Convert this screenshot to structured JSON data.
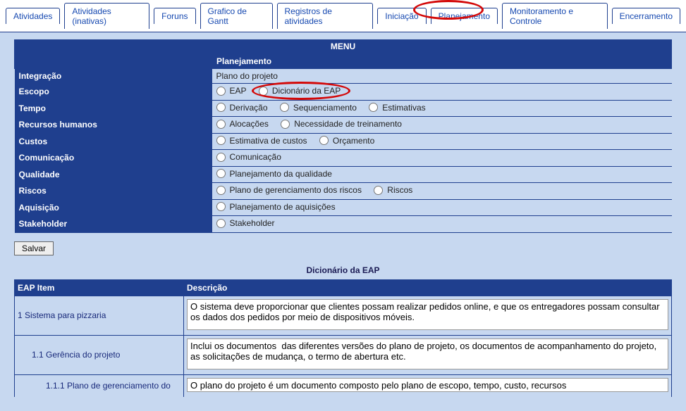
{
  "tabs": [
    {
      "label": "Atividades"
    },
    {
      "label": "Atividades (inativas)"
    },
    {
      "label": "Foruns"
    },
    {
      "label": "Grafico de Gantt"
    },
    {
      "label": "Registros de atividades"
    },
    {
      "label": "Iniciação"
    },
    {
      "label": "Planejamento"
    },
    {
      "label": "Monitoramento e Controle"
    },
    {
      "label": "Encerramento"
    }
  ],
  "menu": {
    "header": "MENU",
    "section_title": "Planejamento",
    "rows": [
      {
        "label": "Integração",
        "plain_text": "Plano do projeto"
      },
      {
        "label": "Escopo",
        "options": [
          "EAP",
          "Dicionário da EAP"
        ]
      },
      {
        "label": "Tempo",
        "options": [
          "Derivação",
          "Sequenciamento",
          "Estimativas"
        ]
      },
      {
        "label": "Recursos humanos",
        "options": [
          "Alocações",
          "Necessidade de treinamento"
        ]
      },
      {
        "label": "Custos",
        "options": [
          "Estimativa de custos",
          "Orçamento"
        ]
      },
      {
        "label": "Comunicação",
        "options": [
          "Comunicação"
        ]
      },
      {
        "label": "Qualidade",
        "options": [
          "Planejamento da qualidade"
        ]
      },
      {
        "label": "Riscos",
        "options": [
          "Plano de gerenciamento dos riscos",
          "Riscos"
        ]
      },
      {
        "label": "Aquisição",
        "options": [
          "Planejamento de aquisições"
        ]
      },
      {
        "label": "Stakeholder",
        "options": [
          "Stakeholder"
        ]
      }
    ]
  },
  "save_button": "Salvar",
  "dictionary": {
    "title": "Dicionário da EAP",
    "col_item": "EAP Item",
    "col_desc": "Descrição",
    "rows": [
      {
        "item": "1 Sistema para pizzaria",
        "desc": "O sistema deve proporcionar que clientes possam realizar pedidos online, e que os entregadores possam consultar os dados dos pedidos por meio de dispositivos móveis."
      },
      {
        "item": "1.1 Gerência do projeto",
        "desc": "Inclui os documentos  das diferentes versões do plano de projeto, os documentos de acompanhamento do projeto, as solicitações de mudança, o termo de abertura etc."
      },
      {
        "item": "1.1.1 Plano de gerenciamento do",
        "desc": "O plano do projeto é um documento composto pelo plano de escopo, tempo, custo, recursos"
      }
    ]
  }
}
